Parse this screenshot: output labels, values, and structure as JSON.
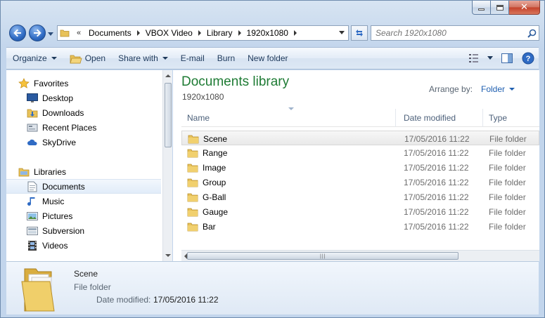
{
  "address": {
    "chevrons": "«",
    "crumbs": [
      "Documents",
      "VBOX Video",
      "Library",
      "1920x1080"
    ]
  },
  "search": {
    "placeholder": "Search 1920x1080"
  },
  "toolbar": {
    "organize": "Organize",
    "open": "Open",
    "share_with": "Share with",
    "email": "E-mail",
    "burn": "Burn",
    "new_folder": "New folder"
  },
  "nav_tree": {
    "favorites": "Favorites",
    "favorites_items": [
      "Desktop",
      "Downloads",
      "Recent Places",
      "SkyDrive"
    ],
    "libraries": "Libraries",
    "libraries_items": [
      "Documents",
      "Music",
      "Pictures",
      "Subversion",
      "Videos"
    ],
    "selected": "Documents"
  },
  "library": {
    "title": "Documents library",
    "subtitle": "1920x1080",
    "arrange_label": "Arrange by:",
    "arrange_value": "Folder"
  },
  "columns": {
    "name": "Name",
    "date": "Date modified",
    "type": "Type"
  },
  "files": [
    {
      "name": "Scene",
      "date": "17/05/2016 11:22",
      "type": "File folder"
    },
    {
      "name": "Range",
      "date": "17/05/2016 11:22",
      "type": "File folder"
    },
    {
      "name": "Image",
      "date": "17/05/2016 11:22",
      "type": "File folder"
    },
    {
      "name": "Group",
      "date": "17/05/2016 11:22",
      "type": "File folder"
    },
    {
      "name": "G-Ball",
      "date": "17/05/2016 11:22",
      "type": "File folder"
    },
    {
      "name": "Gauge",
      "date": "17/05/2016 11:22",
      "type": "File folder"
    },
    {
      "name": "Bar",
      "date": "17/05/2016 11:22",
      "type": "File folder"
    }
  ],
  "details": {
    "name": "Scene",
    "type": "File folder",
    "date_label": "Date modified:",
    "date_value": "17/05/2016 11:22"
  },
  "colors": {
    "library_title": "#1e7b34",
    "link_blue": "#1f5fb0",
    "folder_yellow": "#e8c25a"
  }
}
